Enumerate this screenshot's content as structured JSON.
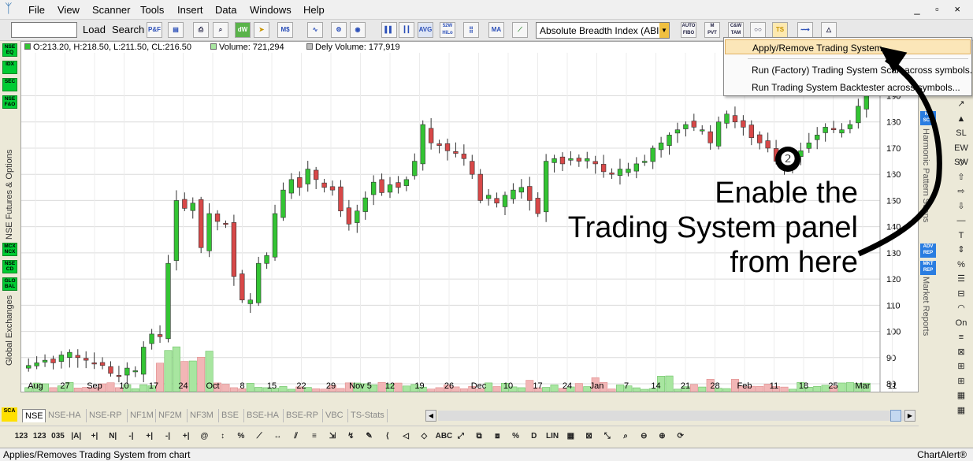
{
  "menubar": {
    "items": [
      "File",
      "View",
      "Scanner",
      "Tools",
      "Insert",
      "Data",
      "Windows",
      "Help"
    ],
    "window_controls": "_ ▫ ×"
  },
  "toolbar": {
    "symbol_value": "",
    "load_label": "Load",
    "search_label": "Search",
    "indicator_selected": "Absolute Breadth Index (ABI",
    "icon_labels": {
      "pnf": "P&F",
      "save": "▤",
      "print": "⎙",
      "preview": "⌕",
      "dw": "dW",
      "arrows": "➤",
      "ms": "M$",
      "wave": "∿",
      "settings": "⚙",
      "web": "◉",
      "bar": "▌▌",
      "candle": "┃┃",
      "avg": "AVG",
      "hilo": "52W HiLo",
      "chart2": "⣿",
      "ma": "MA",
      "trend": "⟋",
      "autofib": "AUTO FIBO",
      "mpvt": "M PVT",
      "cdwtam": "C&W TAM",
      "oo": "○○",
      "ts": "TS",
      "tsgo": "⟿",
      "shapes": "△"
    }
  },
  "left_panel": {
    "buttons": [
      "NSE EQ",
      "IDX",
      "SEC",
      "NSE F&O",
      "MCX NCX",
      "NSE CD",
      "GLO BAL"
    ],
    "label_futures": "NSE Futures & Options",
    "label_global": "Global Exchanges"
  },
  "chart_info": {
    "ohlc": "O:213.20, H:218.50, L:211.50, CL:216.50",
    "volume": "Volume: 721,294",
    "dely_volume": "Dely Volume: 177,919"
  },
  "ts_menu": {
    "items": [
      "Apply/Remove Trading System",
      "Run (Factory) Trading System Scan across symbols...",
      "Run Trading System Backtester across symbols..."
    ]
  },
  "annotation": {
    "number": "❷",
    "lines": [
      "Enable the",
      "Trading System panel",
      "from here"
    ]
  },
  "right_panel": {
    "buttons": [
      "HP SCN",
      "ADV REP",
      "MKT REP"
    ],
    "label_harmonic": "Harmonic Pattern Scans",
    "label_market": "Market Reports",
    "tool_labels": [
      "↗",
      "▲",
      "SL",
      "EW SW",
      "◇",
      "⇧",
      "⇨",
      "⇩",
      "—",
      "T",
      "⇕",
      "%",
      "☰",
      "⊟",
      "◠",
      "On",
      "≡",
      "⊠",
      "⊞",
      "⊞",
      "▦",
      "▦"
    ]
  },
  "tabs": [
    "NSE",
    "NSE-HA",
    "NSE-RP",
    "NF1M",
    "NF2M",
    "NF3M",
    "BSE",
    "BSE-HA",
    "BSE-RP",
    "VBC",
    "TS-Stats"
  ],
  "sca_badge": "SCA",
  "bottom_toolbar": {
    "icons": [
      "123",
      "123",
      "035",
      "|A|",
      "+|",
      "N|",
      "-|",
      "+|",
      "-|",
      "+|",
      "@",
      "↕",
      "%",
      "⟋",
      "↔",
      "⫽",
      "≡",
      "⇲",
      "↯",
      "✎",
      "⟨",
      "◁",
      "◇",
      "ABC",
      "⤢",
      "⧉",
      "⧈",
      "%",
      "D",
      "LIN",
      "▦",
      "⊠",
      "⤡",
      "⌕",
      "⊖",
      "⊕",
      "⟳"
    ]
  },
  "status": {
    "text": "Applies/Removes Trading System from chart",
    "app_name": "ChartAlert®"
  },
  "chart_data": {
    "type": "candlestick",
    "price_axis": {
      "ticks": [
        80,
        90,
        100,
        110,
        120,
        130,
        140,
        150,
        160,
        170,
        180,
        190
      ],
      "range": [
        77,
        204
      ]
    },
    "date_axis": {
      "labels": [
        "Aug",
        "27",
        "Sep",
        "10",
        "17",
        "24",
        "Oct",
        "8",
        "15",
        "22",
        "29",
        "Nov 5",
        "12",
        "19",
        "26",
        "Dec",
        "10",
        "17",
        "24",
        "Jan",
        "7",
        "14",
        "21",
        "28",
        "Feb",
        "11",
        "18",
        "25",
        "Mar",
        "11"
      ]
    },
    "colors": {
      "up": "#33c433",
      "down": "#d84848",
      "up_volume": "#a8e6a0",
      "down_volume": "#f2b6b6",
      "grid": "#dcdcdc"
    },
    "closes": [
      87,
      88,
      89,
      88,
      91,
      92,
      90,
      89,
      88,
      87,
      84,
      83,
      86,
      85,
      94,
      99,
      98,
      126,
      150,
      147,
      149,
      132,
      145,
      142,
      141,
      121,
      112,
      112,
      126,
      129,
      145,
      154,
      158,
      155,
      162,
      158,
      155,
      154,
      146,
      141,
      146,
      151,
      157,
      153,
      156,
      155,
      158,
      165,
      179,
      172,
      171,
      169,
      168,
      166,
      160,
      150,
      152,
      149,
      152,
      154,
      155,
      150,
      145,
      165,
      166,
      164,
      166,
      165,
      166,
      164,
      161,
      160,
      162,
      162,
      164,
      165,
      170,
      172,
      175,
      177,
      179,
      178,
      177,
      172,
      180,
      183,
      180,
      178,
      174,
      172,
      170,
      165,
      163,
      167,
      169,
      172,
      175,
      178,
      177,
      177,
      179,
      186,
      194
    ]
  }
}
